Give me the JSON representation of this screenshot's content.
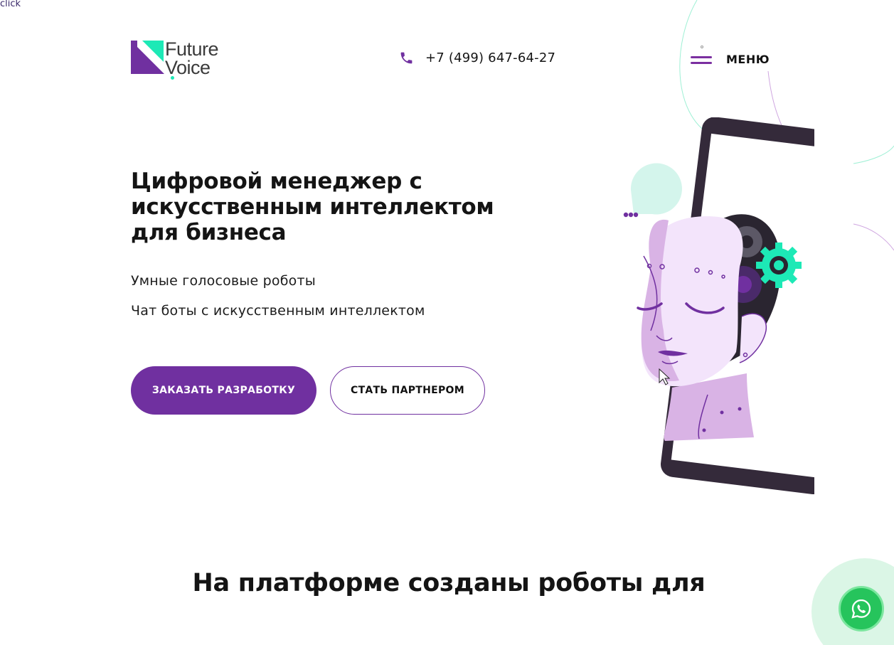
{
  "debug": {
    "label": "click"
  },
  "brand": {
    "line1": "Future",
    "line2": "Voice",
    "colors": {
      "primary": "#7030a0",
      "accent": "#1de9b6"
    }
  },
  "header": {
    "phone_icon": "phone-icon",
    "phone": "+7 (499) 647-64-27",
    "menu_icon": "hamburger-icon",
    "menu_label": "МЕНЮ"
  },
  "hero": {
    "title": "Цифровой менеджер с искусственным интеллектом для бизнеса",
    "subtitle1": "Умные голосовые роботы",
    "subtitle2": "Чат боты с искусственным интеллектом",
    "cta_primary": "ЗАКАЗАТЬ РАЗРАБОТКУ",
    "cta_secondary": "СТАТЬ ПАРТНЕРОМ",
    "illustration": "robot-head-in-phone"
  },
  "section": {
    "title": "На платформе созданы роботы для"
  },
  "widget": {
    "icon": "whatsapp-icon",
    "color": "#26c45c"
  }
}
